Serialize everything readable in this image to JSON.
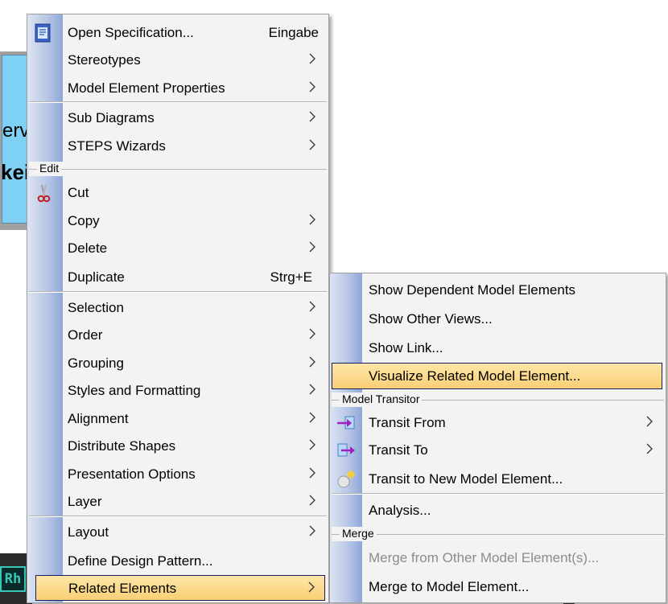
{
  "background": {
    "diagram_text_1": "erv",
    "diagram_text_2": "keit",
    "taskbar_icon": "Rh"
  },
  "main_menu": {
    "items": [
      {
        "label": "Open Specification...",
        "shortcut": "Eingabe",
        "icon": "specification-icon"
      },
      {
        "label": "Stereotypes"
      },
      {
        "label": "Model Element Properties"
      },
      {
        "label": "Sub Diagrams"
      },
      {
        "label": "STEPS Wizards"
      },
      {
        "label": "Cut",
        "icon": "scissors-icon"
      },
      {
        "label": "Copy"
      },
      {
        "label": "Delete"
      },
      {
        "label": "Duplicate",
        "shortcut": "Strg+E"
      },
      {
        "label": "Selection"
      },
      {
        "label": "Order"
      },
      {
        "label": "Grouping"
      },
      {
        "label": "Styles and Formatting"
      },
      {
        "label": "Alignment"
      },
      {
        "label": "Distribute Shapes"
      },
      {
        "label": "Presentation Options"
      },
      {
        "label": "Layer"
      },
      {
        "label": "Layout"
      },
      {
        "label": "Define Design Pattern..."
      },
      {
        "label": "Related Elements"
      }
    ],
    "groups": {
      "edit": "Edit"
    }
  },
  "sub_menu": {
    "items": [
      {
        "label": "Show Dependent Model Elements"
      },
      {
        "label": "Show Other Views..."
      },
      {
        "label": "Show Link..."
      },
      {
        "label": "Visualize Related Model Element..."
      },
      {
        "label": "Transit From",
        "icon": "transit-from-icon"
      },
      {
        "label": "Transit To",
        "icon": "transit-to-icon"
      },
      {
        "label": "Transit to New Model Element...",
        "icon": "new-model-element-icon"
      },
      {
        "label": "Analysis..."
      },
      {
        "label": "Merge from Other Model Element(s)...",
        "disabled": true
      },
      {
        "label": "Merge to Model Element..."
      }
    ],
    "groups": {
      "model_transitor": "Model Transitor",
      "merge": "Merge"
    }
  },
  "colors": {
    "highlight": "#f9cf75",
    "highlight_border": "#1a1a5c",
    "menu_background": "#f3f3f3",
    "gutter": "#8ea6d8",
    "disabled_text": "#8c8c8c"
  }
}
